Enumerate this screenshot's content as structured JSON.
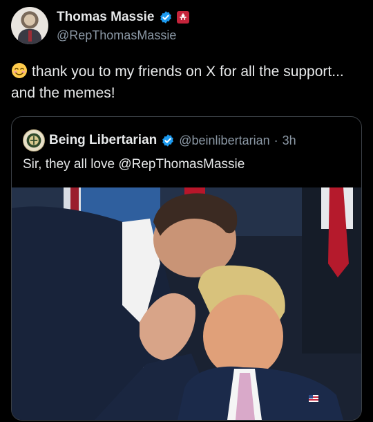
{
  "post": {
    "author": {
      "display_name": "Thomas Massie",
      "handle": "@RepThomasMassie",
      "verified": true,
      "government_badge": true
    },
    "text": "thank you to my friends on X for all the support... and the memes!",
    "emoji": "smiling-face-icon",
    "quoted_post": {
      "author": {
        "display_name": "Being Libertarian",
        "handle": "@beinlibertarian",
        "verified": true
      },
      "separator": "·",
      "time": "3h",
      "text": "Sir, they all love @RepThomasMassie",
      "media": "photo"
    }
  },
  "colors": {
    "background": "#000000",
    "text_primary": "#e7e9ea",
    "text_secondary": "#8b98a5",
    "verified_blue": "#1d9bf0",
    "border": "#3b4046",
    "gov_badge": "#c4243b"
  }
}
